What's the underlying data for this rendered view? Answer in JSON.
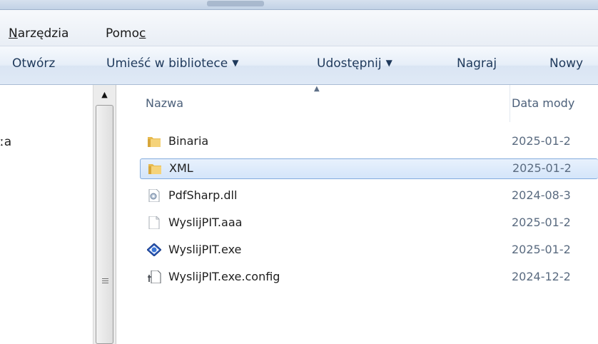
{
  "menu": {
    "items": [
      {
        "label_first": "N",
        "label_rest": "arzędzia"
      },
      {
        "label_first": "Pomo",
        "label_rest": "c"
      }
    ]
  },
  "toolbar": {
    "open": "Otwórz",
    "library": "Umieść w bibliotece",
    "share": "Udostępnij",
    "burn": "Nagraj",
    "new": "Nowy"
  },
  "nav": {
    "partial_item": "ːa"
  },
  "list": {
    "columns": {
      "name": "Nazwa",
      "date": "Data mody"
    },
    "rows": [
      {
        "name": "Binaria",
        "date": "2025-01-2",
        "icon": "folder-icon",
        "selected": false
      },
      {
        "name": "XML",
        "date": "2025-01-2",
        "icon": "folder-icon",
        "selected": true
      },
      {
        "name": "PdfSharp.dll",
        "date": "2024-08-3",
        "icon": "dll-file-icon",
        "selected": false
      },
      {
        "name": "WyslijPIT.aaa",
        "date": "2025-01-2",
        "icon": "blank-file-icon",
        "selected": false
      },
      {
        "name": "WyslijPIT.exe",
        "date": "2025-01-2",
        "icon": "app-exe-icon",
        "selected": false
      },
      {
        "name": "WyslijPIT.exe.config",
        "date": "2024-12-2",
        "icon": "config-file-icon",
        "selected": false
      }
    ]
  },
  "colors": {
    "selection_border": "#84acdd",
    "command_text": "#1e395b",
    "header_text": "#4c607a"
  }
}
